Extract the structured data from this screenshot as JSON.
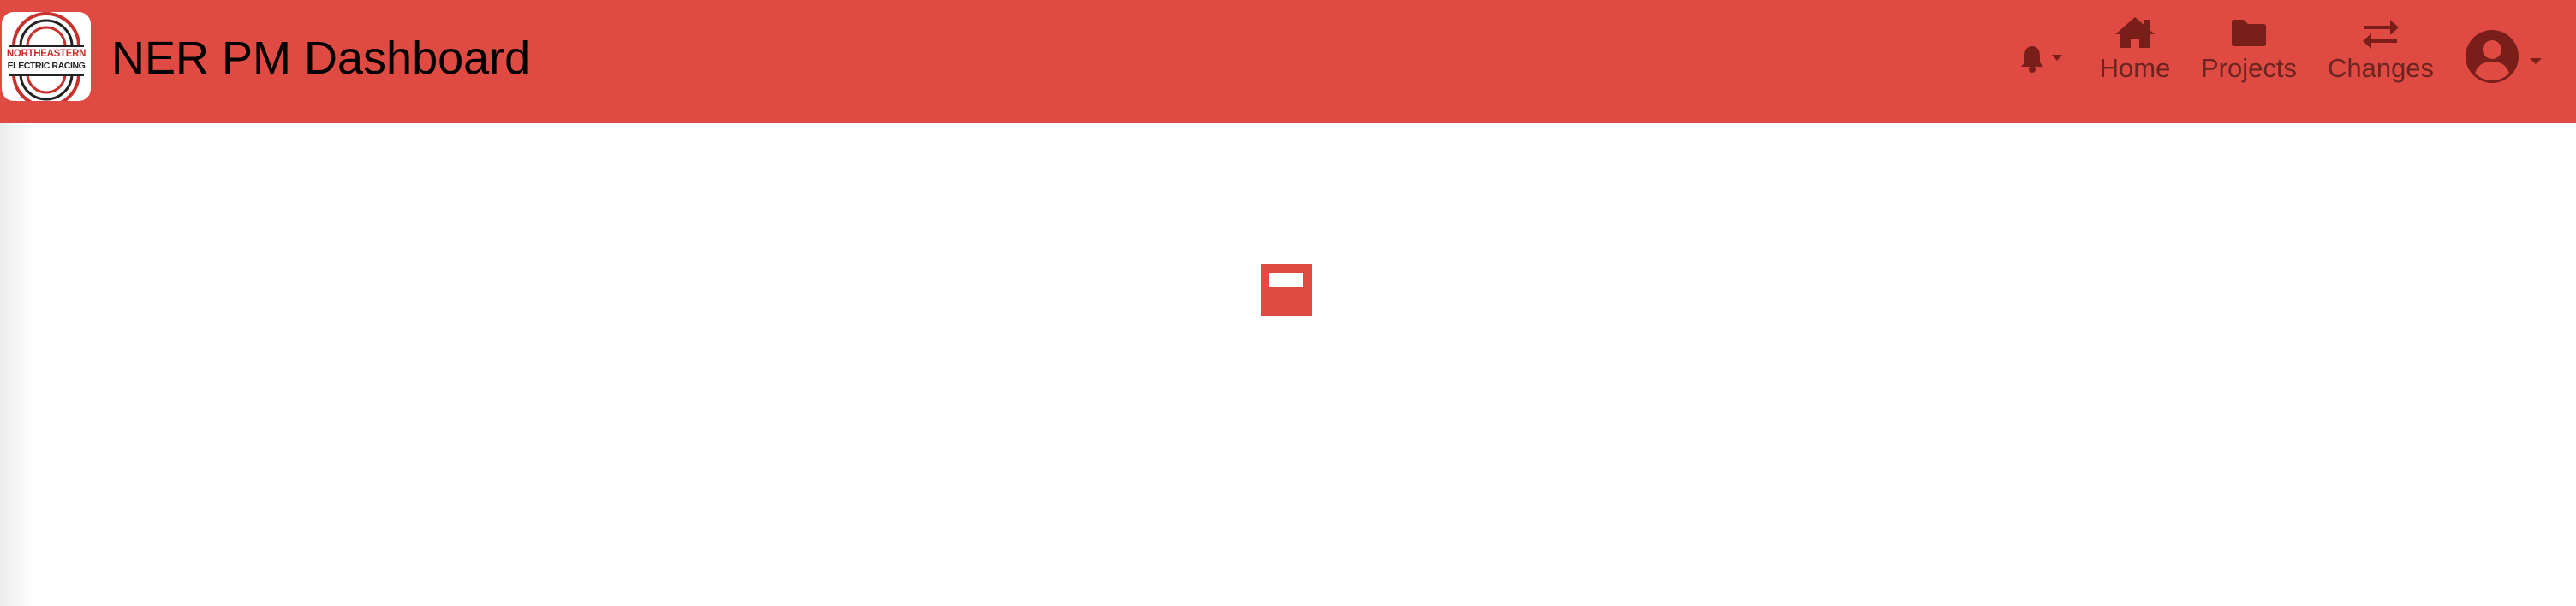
{
  "app": {
    "title": "NER PM Dashboard",
    "logo": {
      "line1": "NORTHEASTERN",
      "line2": "ELECTRIC RACING"
    }
  },
  "nav": {
    "items": [
      {
        "label": "Home",
        "icon": "home-icon"
      },
      {
        "label": "Projects",
        "icon": "folder-icon"
      },
      {
        "label": "Changes",
        "icon": "exchange-arrows-icon"
      }
    ],
    "notifications_icon": "bell-icon",
    "profile_icon": "user-circle-icon"
  },
  "colors": {
    "brand": "#df4b43",
    "nav_text": "#6b2420",
    "title_text": "#000000"
  },
  "content": {
    "loading_indicator": "loader"
  }
}
